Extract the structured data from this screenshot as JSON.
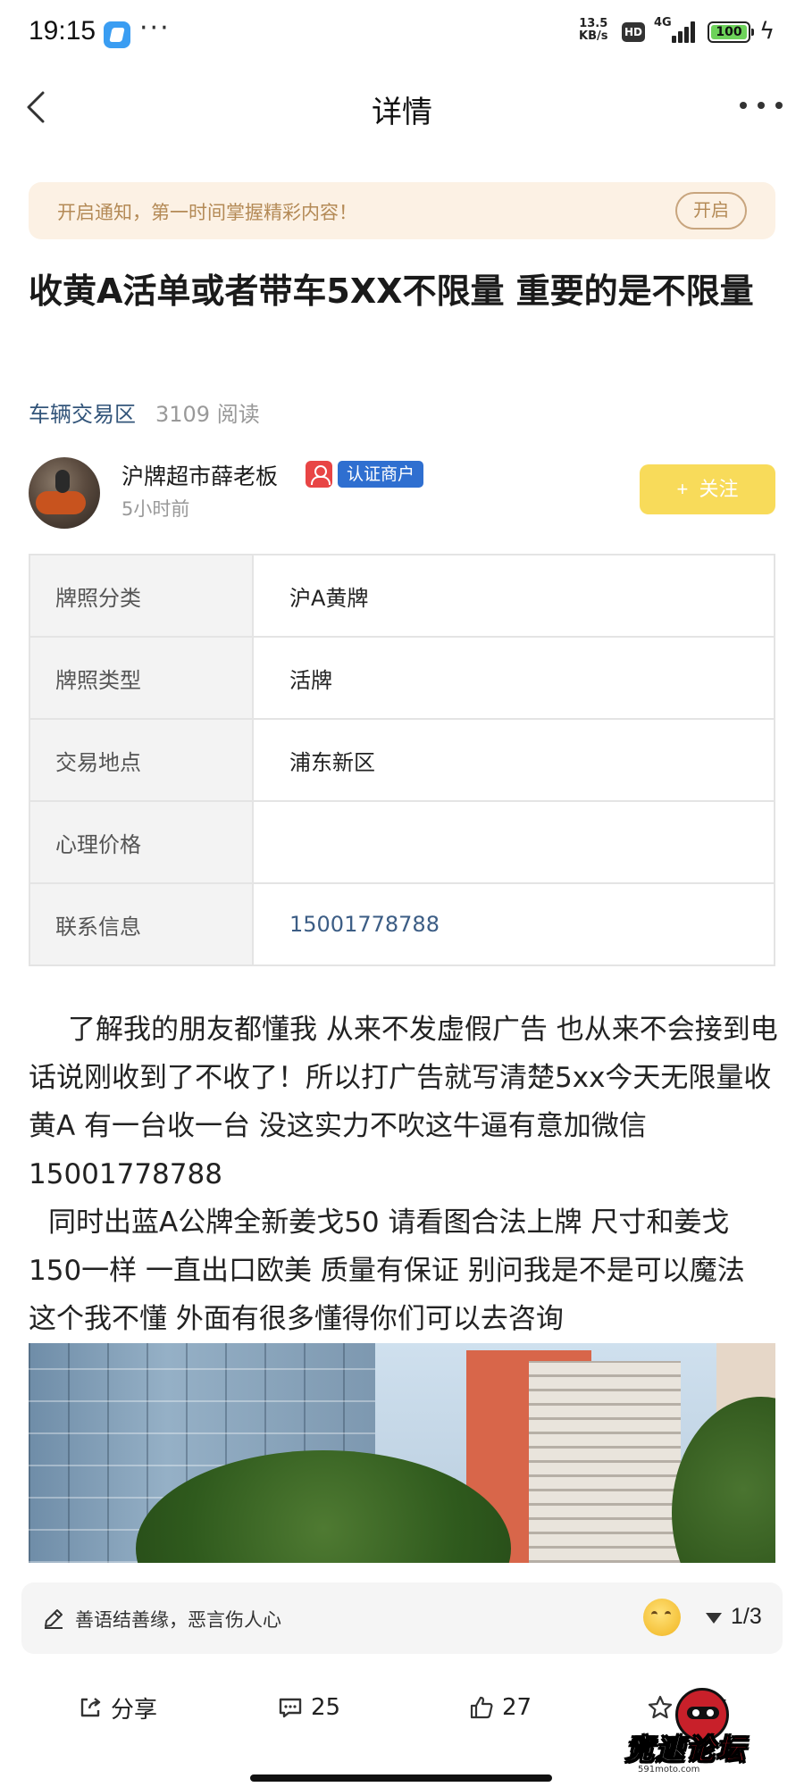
{
  "status_bar": {
    "time": "19:15",
    "dots": "···",
    "net_speed_value": "13.5",
    "net_speed_unit": "KB/s",
    "hd": "HD",
    "network": "4G",
    "battery": "100",
    "battery_level": 1.0
  },
  "header": {
    "title": "详情"
  },
  "notice": {
    "text": "开启通知，第一时间掌握精彩内容！",
    "button": "开启"
  },
  "post": {
    "title": "收黄A活单或者带车5XX不限量 重要的是不限量",
    "category": "车辆交易区",
    "reads": "3109 阅读",
    "author": {
      "name": "沪牌超市薛老板",
      "badge": "认证商户",
      "time": "5小时前",
      "follow_button": "关注",
      "follow_plus": "+"
    },
    "info_rows": [
      {
        "label": "牌照分类",
        "value": "沪A黄牌"
      },
      {
        "label": "牌照类型",
        "value": "活牌"
      },
      {
        "label": "交易地点",
        "value": "浦东新区"
      },
      {
        "label": "心理价格",
        "value": ""
      },
      {
        "label": "联系信息",
        "value": "15001778788"
      }
    ],
    "paragraphs": [
      "了解我的朋友都懂我 从来不发虚假广告 也从来不会接到电话说刚收到了不收了！所以打广告就写清楚5xx今天无限量收黄A 有一台收一台 没这实力不吹这牛逼有意加微信15001778788",
      "同时出蓝A公牌全新姜戈50 请看图合法上牌 尺寸和姜戈150一样 一直出口欧美 质量有保证 别问我是不是可以魔法 这个我不懂 外面有很多懂得你们可以去咨询"
    ]
  },
  "bottom": {
    "comment_placeholder": "善语结善缘，恶言伤人心",
    "page_indicator": "1/3",
    "share": "分享",
    "comments": "25",
    "likes": "27",
    "favorite": "收藏"
  },
  "watermark": {
    "text_a": "竞速",
    "text_b": "论坛",
    "url": "591moto.com"
  }
}
